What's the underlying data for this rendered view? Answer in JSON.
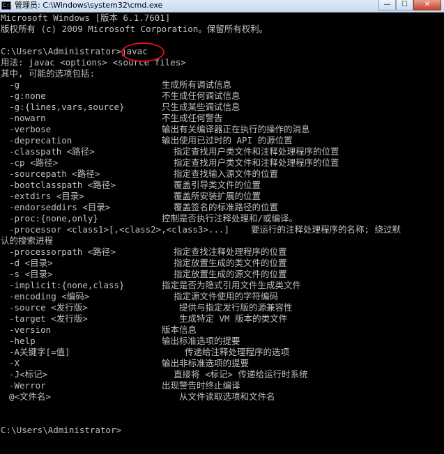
{
  "window": {
    "title": "管理员: C:\\Windows\\system32\\cmd.exe",
    "icon": "cmd-icon",
    "minimize_glyph": "—",
    "maximize_glyph": "☐",
    "close_glyph": "✕"
  },
  "console": {
    "header": [
      "Microsoft Windows [版本 6.1.7601]",
      "版权所有 (c) 2009 Microsoft Corporation。保留所有权利。"
    ],
    "prompt": "C:\\Users\\Administrator>",
    "command": "javac",
    "usage": "用法: javac <options> <source files>",
    "options_intro": "其中, 可能的选项包括:",
    "options": [
      {
        "flag": "-g",
        "desc": "生成所有调试信息"
      },
      {
        "flag": "-g:none",
        "desc": "不生成任何调试信息"
      },
      {
        "flag": "-g:{lines,vars,source}",
        "desc": "只生成某些调试信息"
      },
      {
        "flag": "-nowarn",
        "desc": "不生成任何警告"
      },
      {
        "flag": "-verbose",
        "desc": "输出有关编译器正在执行的操作的消息"
      },
      {
        "flag": "-deprecation",
        "desc": "输出使用已过时的 API 的源位置"
      },
      {
        "flag": "-classpath <路径>",
        "desc": "指定查找用户类文件和注释处理程序的位置"
      },
      {
        "flag": "-cp <路径>",
        "desc": "指定查找用户类文件和注释处理程序的位置"
      },
      {
        "flag": "-sourcepath <路径>",
        "desc": "指定查找输入源文件的位置"
      },
      {
        "flag": "-bootclasspath <路径>",
        "desc": "覆盖引导类文件的位置"
      },
      {
        "flag": "-extdirs <目录>",
        "desc": "覆盖所安装扩展的位置"
      },
      {
        "flag": "-endorseddirs <目录>",
        "desc": "覆盖签名的标准路径的位置"
      },
      {
        "flag": "-proc:{none,only}",
        "desc": "控制是否执行注释处理和/或编译。"
      },
      {
        "flag": "-processor <class1>[,<class2>,<class3>...]",
        "desc": "要运行的注释处理程序的名称; 绕过默"
      },
      {
        "continuation": "认的搜索进程"
      },
      {
        "flag": "-processorpath <路径>",
        "desc": "指定查找注释处理程序的位置"
      },
      {
        "flag": "-d <目录>",
        "desc": "指定放置生成的类文件的位置"
      },
      {
        "flag": "-s <目录>",
        "desc": "指定放置生成的源文件的位置"
      },
      {
        "flag": "-implicit:{none,class}",
        "desc": "指定是否为隐式引用文件生成类文件"
      },
      {
        "flag": "-encoding <编码>",
        "desc": "指定源文件使用的字符编码"
      },
      {
        "flag": "-source <发行版>",
        "desc": "提供与指定发行版的源兼容性"
      },
      {
        "flag": "-target <发行版>",
        "desc": "生成特定 VM 版本的类文件"
      },
      {
        "flag": "-version",
        "desc": "版本信息"
      },
      {
        "flag": "-help",
        "desc": "输出标准选项的提要"
      },
      {
        "flag": "-A关键字[=值]",
        "desc": "传递给注释处理程序的选项"
      },
      {
        "flag": "-X",
        "desc": "输出非标准选项的提要"
      },
      {
        "flag": "-J<标记>",
        "desc": "直接将 <标记> 传递给运行时系统"
      },
      {
        "flag": "-Werror",
        "desc": "出现警告时终止编译"
      },
      {
        "flag": "@<文件名>",
        "desc": "从文件读取选项和文件名"
      }
    ],
    "final_prompt": "C:\\Users\\Administrator>"
  },
  "colors": {
    "console_background": "#000000",
    "console_text": "#c0c0c0",
    "annotation_ring": "#e01010"
  }
}
